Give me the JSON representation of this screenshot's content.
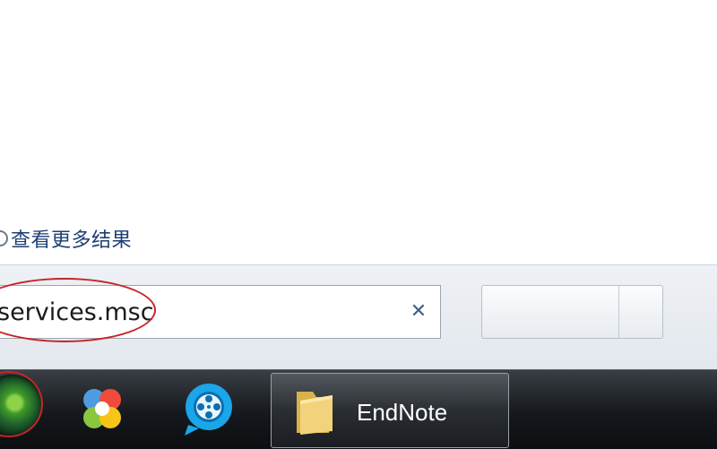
{
  "start_menu": {
    "see_more_results": "查看更多结果",
    "search": {
      "value": "services.msc",
      "clear_glyph": "✕"
    }
  },
  "taskbar": {
    "items": [
      {
        "icon": "pinwheel-app-icon"
      },
      {
        "icon": "media-player-icon"
      },
      {
        "icon": "folder-icon",
        "label": "EndNote"
      }
    ]
  },
  "colors": {
    "annotation_red": "#c6252a",
    "link_blue": "#1f3f74",
    "taskbar_dark": "#15181c"
  }
}
